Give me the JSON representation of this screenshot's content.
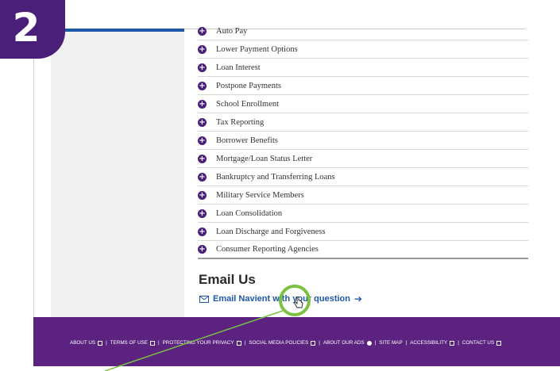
{
  "step": {
    "number": "2"
  },
  "faq": {
    "items": [
      "Auto Pay",
      "Lower Payment Options",
      "Loan Interest",
      "Postpone Payments",
      "School Enrollment",
      "Tax Reporting",
      "Borrower Benefits",
      "Mortgage/Loan Status Letter",
      "Bankruptcy and Transferring Loans",
      "Military Service Members",
      "Loan Consolidation",
      "Loan Discharge and Forgiveness",
      "Consumer Reporting Agencies"
    ]
  },
  "email": {
    "heading": "Email Us",
    "link_label": "Email Navient with your question",
    "arrow": "➔"
  },
  "footer": {
    "links": [
      "ABOUT US",
      "TERMS OF USE",
      "PROTECTING YOUR PRIVACY",
      "SOCIAL MEDIA POLICIES",
      "ABOUT OUR ADS",
      "SITE MAP",
      "ACCESSIBILITY",
      "CONTACT US"
    ],
    "separator": "|"
  },
  "colors": {
    "brand_purple": "#5b2280",
    "badge_purple": "#4a1f7a",
    "link_blue": "#1f57a8",
    "highlight_green": "#7cc242"
  },
  "icons": {
    "faq_expand": "plus-circle-icon",
    "email": "envelope-icon",
    "external": "external-link-icon",
    "cursor": "hand-pointer-icon"
  }
}
